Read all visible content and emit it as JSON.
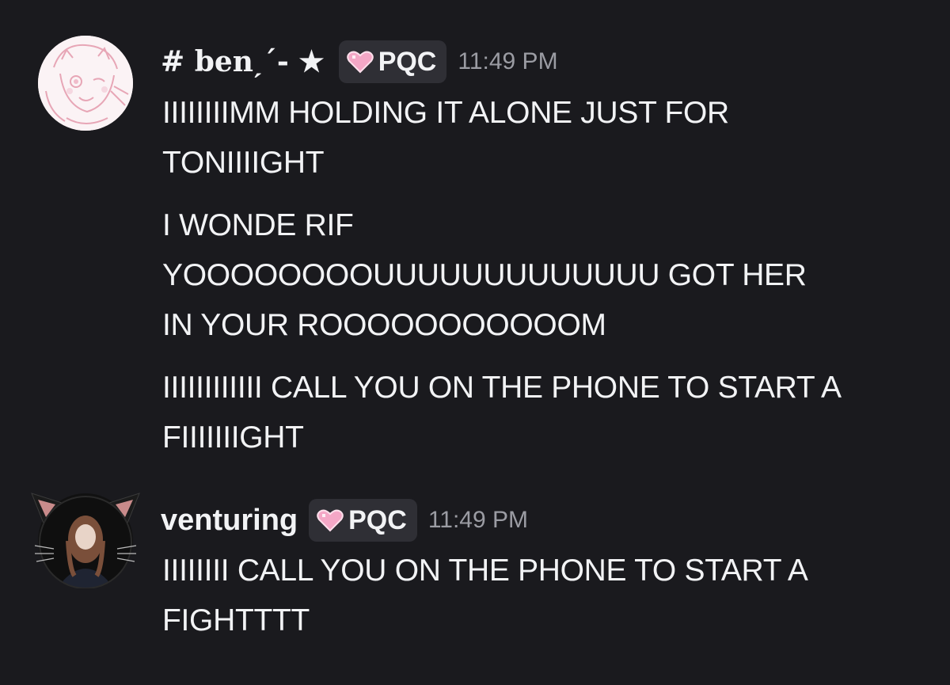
{
  "messages": [
    {
      "author": "# benˏˊ- ★",
      "tag": "PQC",
      "tag_icon": "pink-heart-icon",
      "time": "11:49 PM",
      "paragraphs": [
        [
          "IIIIIIIIMM HOLDING IT ALONE JUST FOR",
          "TONIIIIGHT"
        ],
        [
          "I WONDE RIF",
          "YOOOOOOOOUUUUUUUUUUUUU GOT HER",
          "IN YOUR ROOOOOOOOOOOM"
        ],
        [
          "IIIIIIIIIIII CALL YOU ON THE PHONE TO START A",
          "FIIIIIIIGHT"
        ]
      ]
    },
    {
      "author": "venturing",
      "tag": "PQC",
      "tag_icon": "pink-heart-icon",
      "time": "11:49 PM",
      "paragraphs": [
        [
          "IIIIIIII CALL YOU ON THE PHONE TO START A",
          "FIGHTTTT"
        ]
      ]
    }
  ],
  "colors": {
    "background": "#1a1a1e",
    "text": "#f2f3f5",
    "timestamp": "#9b9ca3",
    "tag_bg": "#2f2f35",
    "heart": "#f4a7c6"
  }
}
